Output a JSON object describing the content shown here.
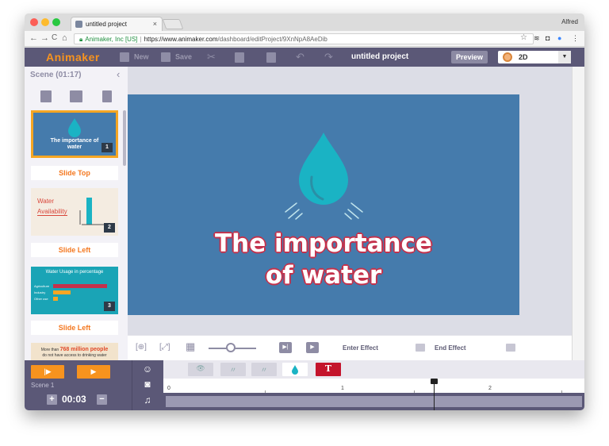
{
  "browser": {
    "tab_title": "untitled project",
    "tab_close": "×",
    "user": "Alfred",
    "back": "←",
    "forward": "→",
    "reload": "C",
    "home": "⌂",
    "site_identity": "Animaker, Inc [US]",
    "url_separator": "|",
    "url_host": "https://www.animaker.com",
    "url_path": "/dashboard/editProject/9XnNpA8AeDib",
    "star": "☆"
  },
  "toolbar": {
    "logo": "Animaker",
    "new_label": "New",
    "save_label": "Save",
    "cut_glyph": "✂",
    "undo_glyph": "↶",
    "redo_glyph": "↷",
    "project_title": "untitled project",
    "preview_label": "Preview",
    "mode_value": "2D",
    "mode_dropdown": "▼"
  },
  "scene_panel": {
    "header": "Scene (01:17)",
    "collapse": "‹",
    "slides": [
      {
        "number": "1",
        "caption": "The importance of water",
        "transition": "Slide Top"
      },
      {
        "number": "2",
        "caption_line1": "Water",
        "caption_line2": "Availability",
        "transition": "Slide Left"
      },
      {
        "number": "3",
        "caption": "Water Usage in percentage",
        "rows": [
          "Agriculture",
          "Industry",
          "Other use"
        ],
        "transition": "Slide Left"
      },
      {
        "caption_pre": "More than",
        "caption_highlight": "768 million people",
        "caption_post": "do not have access to drinking water"
      }
    ]
  },
  "stage": {
    "title_line1": "The importance",
    "title_line2": "of water",
    "bg_color": "#457bac",
    "drop_color": "#1ab3c4",
    "title_outline_color": "#c4314b"
  },
  "effect_bar": {
    "enter_effect_label": "Enter Effect",
    "end_effect_label": "End Effect"
  },
  "timeline": {
    "scene_label": "Scene 1",
    "duration": "00:03",
    "plus": "+",
    "minus": "−",
    "ruler_ticks": [
      "0",
      "1",
      "2"
    ],
    "text_asset": "T",
    "playhead_position": 2.0
  },
  "colors": {
    "toolbar_bg": "#5b5877",
    "accent": "#f7931e",
    "panel_bg": "#f3f2f7",
    "thumb_selected_border": "#f5a623"
  },
  "icons": {
    "new": "new-file-icon",
    "save": "save-icon",
    "copy": "copy-icon",
    "paste": "paste-icon",
    "add_scene": "add-scene-icon",
    "duplicate_scene": "duplicate-scene-icon",
    "delete_scene": "trash-icon",
    "character": "character-icon",
    "camera": "camera-icon",
    "music": "music-icon"
  }
}
